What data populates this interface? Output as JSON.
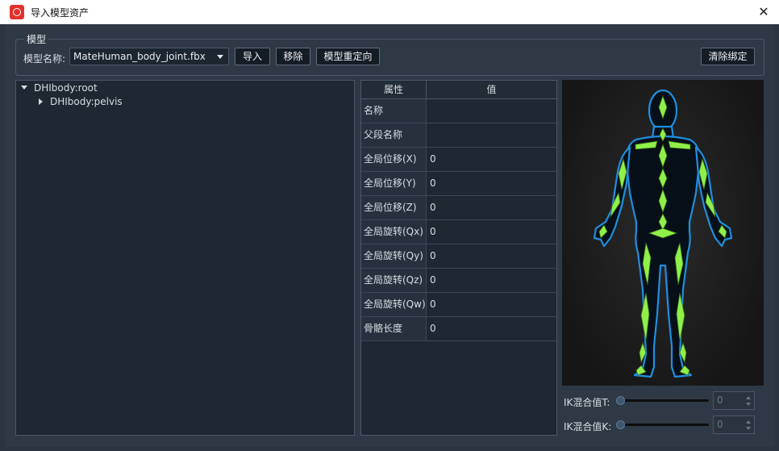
{
  "window": {
    "title": "导入模型资产"
  },
  "group": {
    "title": "模型",
    "model_label": "模型名称:"
  },
  "model_select": {
    "value": "MateHuman_body_joint.fbx"
  },
  "toolbar": {
    "import_label": "导入",
    "remove_label": "移除",
    "retarget_label": "模型重定向",
    "clear_binding_label": "清除绑定"
  },
  "tree": {
    "root": "DHIbody:root",
    "child": "DHIbody:pelvis"
  },
  "table": {
    "header_property": "属性",
    "header_value": "值",
    "rows": [
      {
        "name": "名称",
        "value": ""
      },
      {
        "name": "父段名称",
        "value": ""
      },
      {
        "name": "全局位移(X)",
        "value": "0"
      },
      {
        "name": "全局位移(Y)",
        "value": "0"
      },
      {
        "name": "全局位移(Z)",
        "value": "0"
      },
      {
        "name": "全局旋转(Qx)",
        "value": "0"
      },
      {
        "name": "全局旋转(Qy)",
        "value": "0"
      },
      {
        "name": "全局旋转(Qz)",
        "value": "0"
      },
      {
        "name": "全局旋转(Qw)",
        "value": "0"
      },
      {
        "name": "骨骼长度",
        "value": "0"
      }
    ]
  },
  "ik": {
    "t_label": "IK混合值T:",
    "t_value": "0",
    "k_label": "IK混合值K:",
    "k_value": "0"
  },
  "colors": {
    "bone_green": "#8ff04a",
    "body_outline": "#1f8fe0"
  }
}
